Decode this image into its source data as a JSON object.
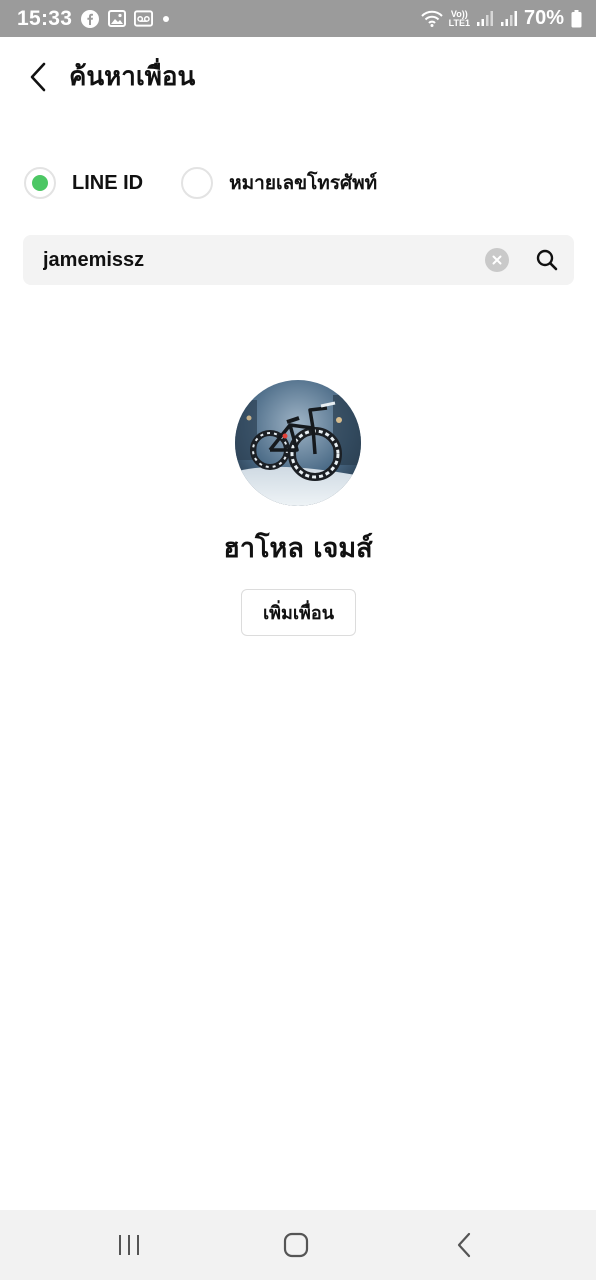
{
  "status_bar": {
    "time": "15:33",
    "network_top": "Vo))",
    "network_bottom": "LTE1",
    "battery_percent": "70%",
    "icons": [
      "facebook-icon",
      "gallery-icon",
      "voicemail-icon",
      "notification-dot-icon",
      "wifi-icon",
      "signal-icon",
      "battery-icon"
    ]
  },
  "header": {
    "title": "ค้นหาเพื่อน",
    "back_icon": "chevron-left-icon"
  },
  "search_type": {
    "options": [
      {
        "label": "LINE ID",
        "selected": true
      },
      {
        "label": "หมายเลขโทรศัพท์",
        "selected": false
      }
    ],
    "accent_color": "#4cc764"
  },
  "search": {
    "value": "jamemissz",
    "clear_icon": "clear-icon",
    "search_icon": "search-icon"
  },
  "result": {
    "name": "ฮาโหล เจมส์",
    "add_button_label": "เพิ่มเพื่อน",
    "avatar": "avatar-snowy-bicycle"
  },
  "nav_bar": {
    "icons": [
      "recent-apps-icon",
      "home-icon",
      "back-icon"
    ]
  }
}
